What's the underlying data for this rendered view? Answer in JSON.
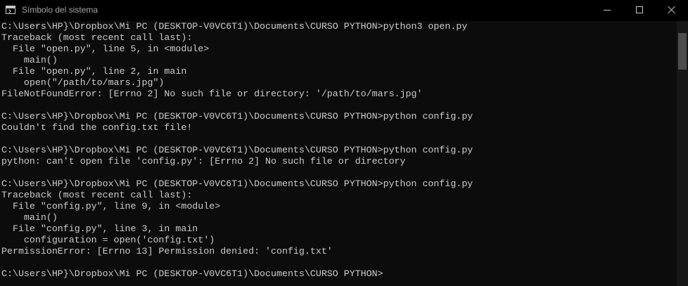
{
  "window": {
    "title": "Símbolo del sistema",
    "icon": "console-app-icon",
    "controls": [
      "minimize-icon",
      "maximize-icon",
      "close-icon"
    ]
  },
  "colors": {
    "background": "#0c0c0c",
    "titlebar": "#000000",
    "text": "#cccccc"
  },
  "console": {
    "lines": [
      "C:\\Users\\HP}\\Dropbox\\Mi PC (DESKTOP-V0VC6T1)\\Documents\\CURSO PYTHON>python3 open.py",
      "Traceback (most recent call last):",
      "  File \"open.py\", line 5, in <module>",
      "    main()",
      "  File \"open.py\", line 2, in main",
      "    open(\"/path/to/mars.jpg\")",
      "FileNotFoundError: [Errno 2] No such file or directory: '/path/to/mars.jpg'",
      "",
      "C:\\Users\\HP}\\Dropbox\\Mi PC (DESKTOP-V0VC6T1)\\Documents\\CURSO PYTHON>python config.py",
      "Couldn't find the config.txt file!",
      "",
      "C:\\Users\\HP}\\Dropbox\\Mi PC (DESKTOP-V0VC6T1)\\Documents\\CURSO PYTHON>python config.py",
      "python: can't open file 'config.py': [Errno 2] No such file or directory",
      "",
      "C:\\Users\\HP}\\Dropbox\\Mi PC (DESKTOP-V0VC6T1)\\Documents\\CURSO PYTHON>python config.py",
      "Traceback (most recent call last):",
      "  File \"config.py\", line 9, in <module>",
      "    main()",
      "  File \"config.py\", line 3, in main",
      "    configuration = open('config.txt')",
      "PermissionError: [Errno 13] Permission denied: 'config.txt'",
      "",
      "C:\\Users\\HP}\\Dropbox\\Mi PC (DESKTOP-V0VC6T1)\\Documents\\CURSO PYTHON>"
    ]
  }
}
